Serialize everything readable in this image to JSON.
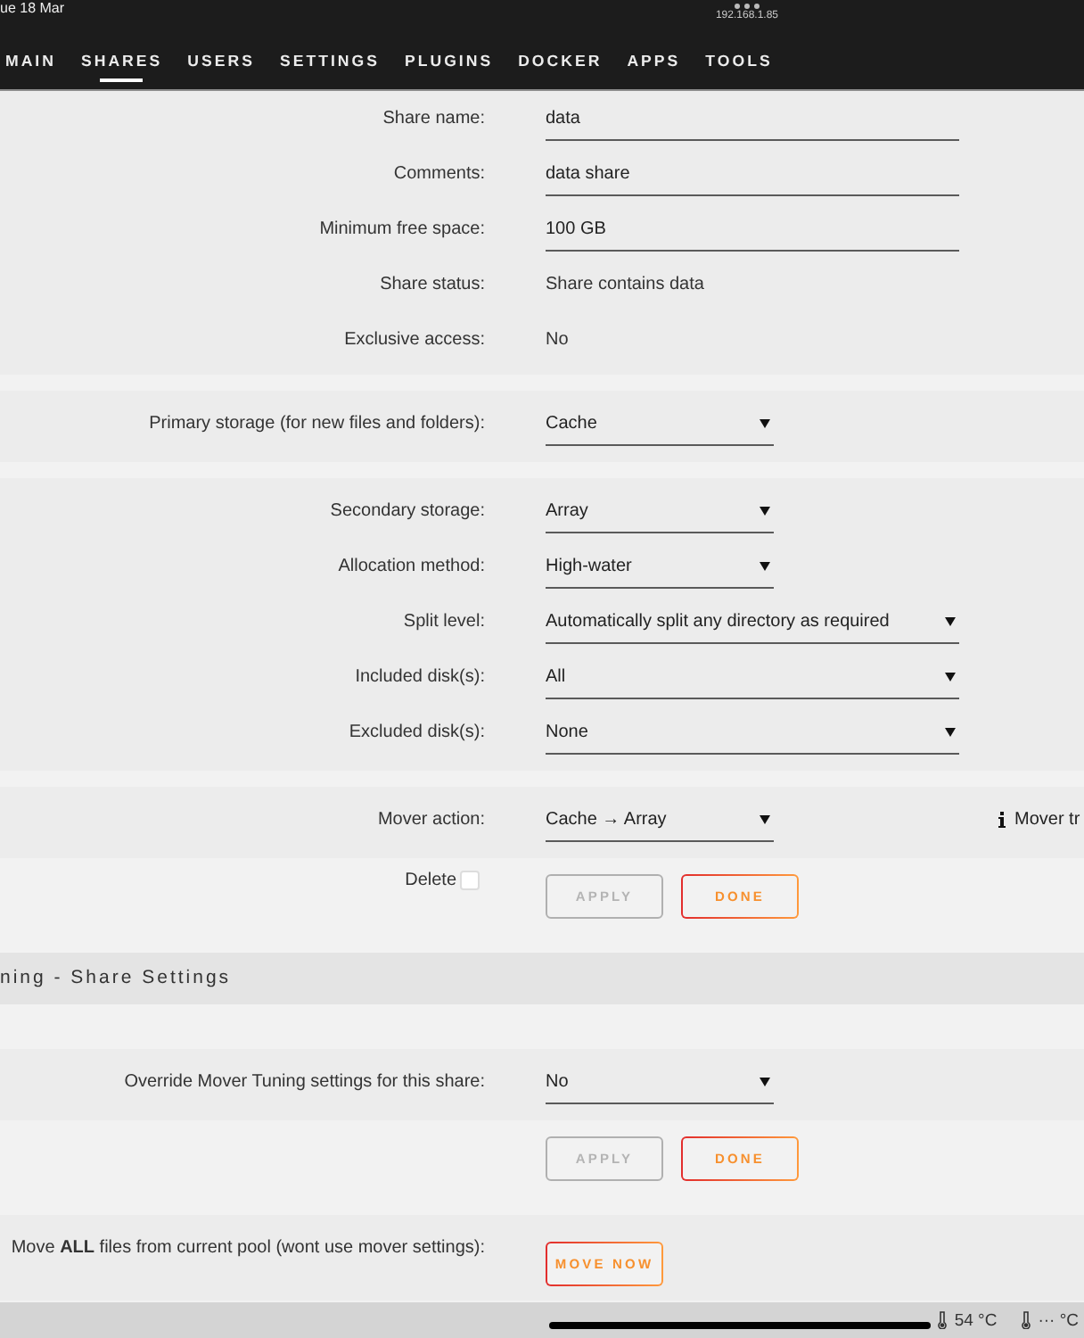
{
  "status_bar": {
    "date": "ue 18 Mar",
    "address": "192.168.1.85"
  },
  "tabs": [
    {
      "label": "MAIN",
      "selected": false
    },
    {
      "label": "SHARES",
      "selected": true
    },
    {
      "label": "USERS",
      "selected": false
    },
    {
      "label": "SETTINGS",
      "selected": false
    },
    {
      "label": "PLUGINS",
      "selected": false
    },
    {
      "label": "DOCKER",
      "selected": false
    },
    {
      "label": "APPS",
      "selected": false
    },
    {
      "label": "TOOLS",
      "selected": false
    }
  ],
  "sections": [
    {
      "kind": "fields",
      "rows": [
        {
          "kind": "input",
          "label": "Share name:",
          "value": "data"
        },
        {
          "kind": "input",
          "label": "Comments:",
          "value": "data share"
        },
        {
          "kind": "input",
          "label": "Minimum free space:",
          "value": "100 GB"
        },
        {
          "kind": "text",
          "label": "Share status:",
          "value": "Share contains data"
        },
        {
          "kind": "text",
          "label": "Exclusive access:",
          "value": "No"
        }
      ]
    },
    {
      "kind": "fields",
      "rows": [
        {
          "kind": "select",
          "label": "Primary storage (for new files and folders):",
          "value": "Cache"
        }
      ]
    },
    {
      "kind": "fields",
      "rows": [
        {
          "kind": "select",
          "label": "Secondary storage:",
          "value": "Array"
        },
        {
          "kind": "select",
          "label": "Allocation method:",
          "value": "High-water"
        },
        {
          "kind": "longselect",
          "label": "Split level:",
          "value": "Automatically split any directory as required"
        },
        {
          "kind": "longselect",
          "label": "Included disk(s):",
          "value": "All"
        },
        {
          "kind": "longselect",
          "label": "Excluded disk(s):",
          "value": "None"
        }
      ]
    },
    {
      "kind": "fields",
      "rows": [
        {
          "kind": "select",
          "label": "Mover action:",
          "value": "Cache → Array",
          "note": "Mover tr"
        }
      ]
    },
    {
      "kind": "actions",
      "delete": {
        "label": "Delete",
        "checked": false
      },
      "buttons": [
        {
          "label": "APPLY",
          "disabled": true
        },
        {
          "label": "DONE",
          "disabled": false
        }
      ]
    },
    {
      "kind": "header",
      "title": "ning - Share Settings"
    },
    {
      "kind": "fields",
      "rows": [
        {
          "kind": "select",
          "label": "Override Mover Tuning settings for this share:",
          "value": "No"
        }
      ]
    },
    {
      "kind": "actions",
      "buttons": [
        {
          "label": "APPLY",
          "disabled": true
        },
        {
          "label": "DONE",
          "disabled": false
        }
      ]
    },
    {
      "kind": "fields",
      "rows": [
        {
          "kind": "button",
          "label": "Move **ALL** files from current pool (wont use mover settings):",
          "value": "MOVE NOW"
        }
      ]
    }
  ],
  "footer": {
    "temperatures": [
      "54 °C",
      "··· °C"
    ]
  }
}
